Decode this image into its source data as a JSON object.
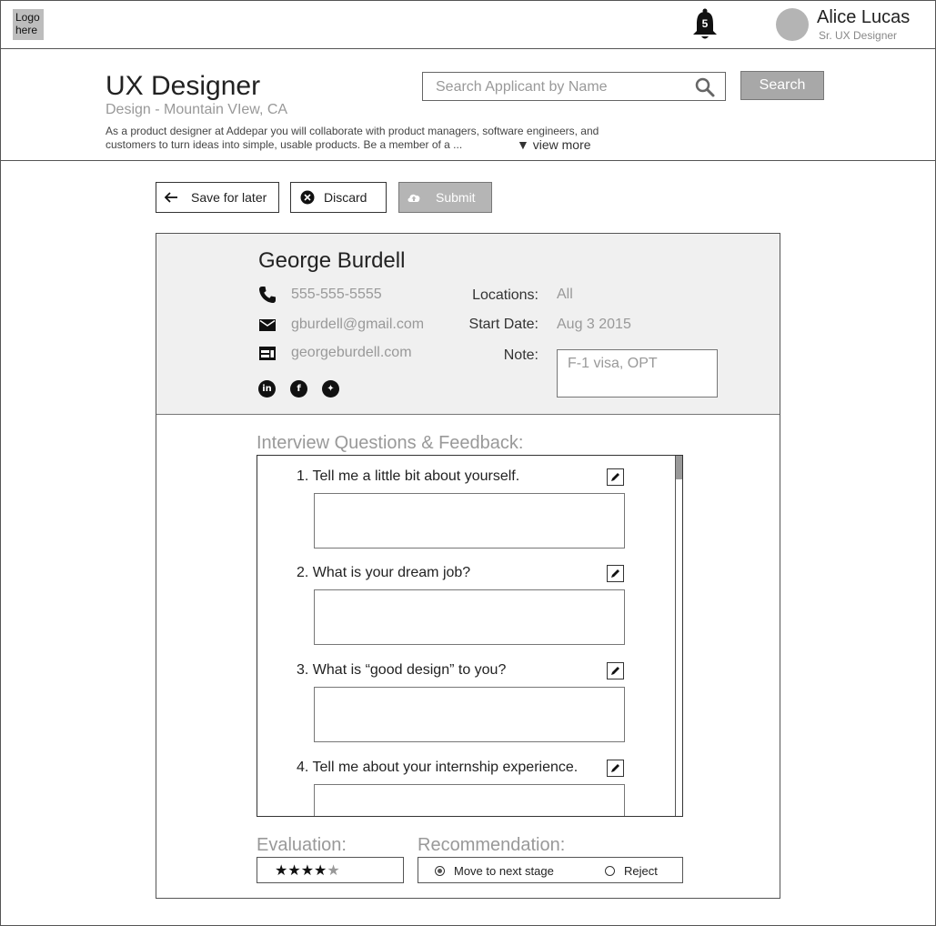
{
  "topbar": {
    "logo_text": "Logo here",
    "notifications": {
      "count": "5",
      "icon": "bell-icon"
    },
    "user": {
      "name": "Alice Lucas",
      "role": "Sr. UX Designer"
    }
  },
  "header": {
    "job_title": "UX Designer",
    "job_subtitle": "Design - Mountain VIew, CA",
    "description": "As a product designer at Addepar you will collaborate with product managers, software engineers, and customers to turn ideas into simple, usable products. Be a member of a ...",
    "view_more_label": "▼ view more",
    "search": {
      "placeholder": "Search Applicant by Name",
      "button_label": "Search"
    }
  },
  "actions": {
    "save_label": "Save for later",
    "discard_label": "Discard",
    "submit_label": "Submit"
  },
  "candidate": {
    "name": "George Burdell",
    "phone": "555-555-5555",
    "email": "gburdell@gmail.com",
    "website": "georgeburdell.com",
    "social": [
      "linkedin-icon",
      "facebook-icon",
      "twitter-icon"
    ],
    "fields": {
      "locations_label": "Locations:",
      "locations_value": "All",
      "start_date_label": "Start Date:",
      "start_date_value": "Aug 3  2015",
      "note_label": "Note:",
      "note_value": "F-1 visa, OPT"
    }
  },
  "questions": {
    "title": "Interview Questions & Feedback:",
    "items": [
      {
        "text": "1. Tell me a little bit about yourself."
      },
      {
        "text": "2. What is your dream job?"
      },
      {
        "text": "3. What is “good design” to you?"
      },
      {
        "text": "4. Tell me about your internship experience."
      }
    ]
  },
  "evaluation": {
    "label": "Evaluation:",
    "rating": 4,
    "max": 5
  },
  "recommendation": {
    "label": "Recommendation:",
    "options": [
      {
        "label": "Move to next stage",
        "selected": true
      },
      {
        "label": "Reject",
        "selected": false
      }
    ]
  },
  "colors": {
    "muted_text": "#999999",
    "header_panel": "#f0f0f0",
    "disabled_button": "#b5b5b5"
  }
}
